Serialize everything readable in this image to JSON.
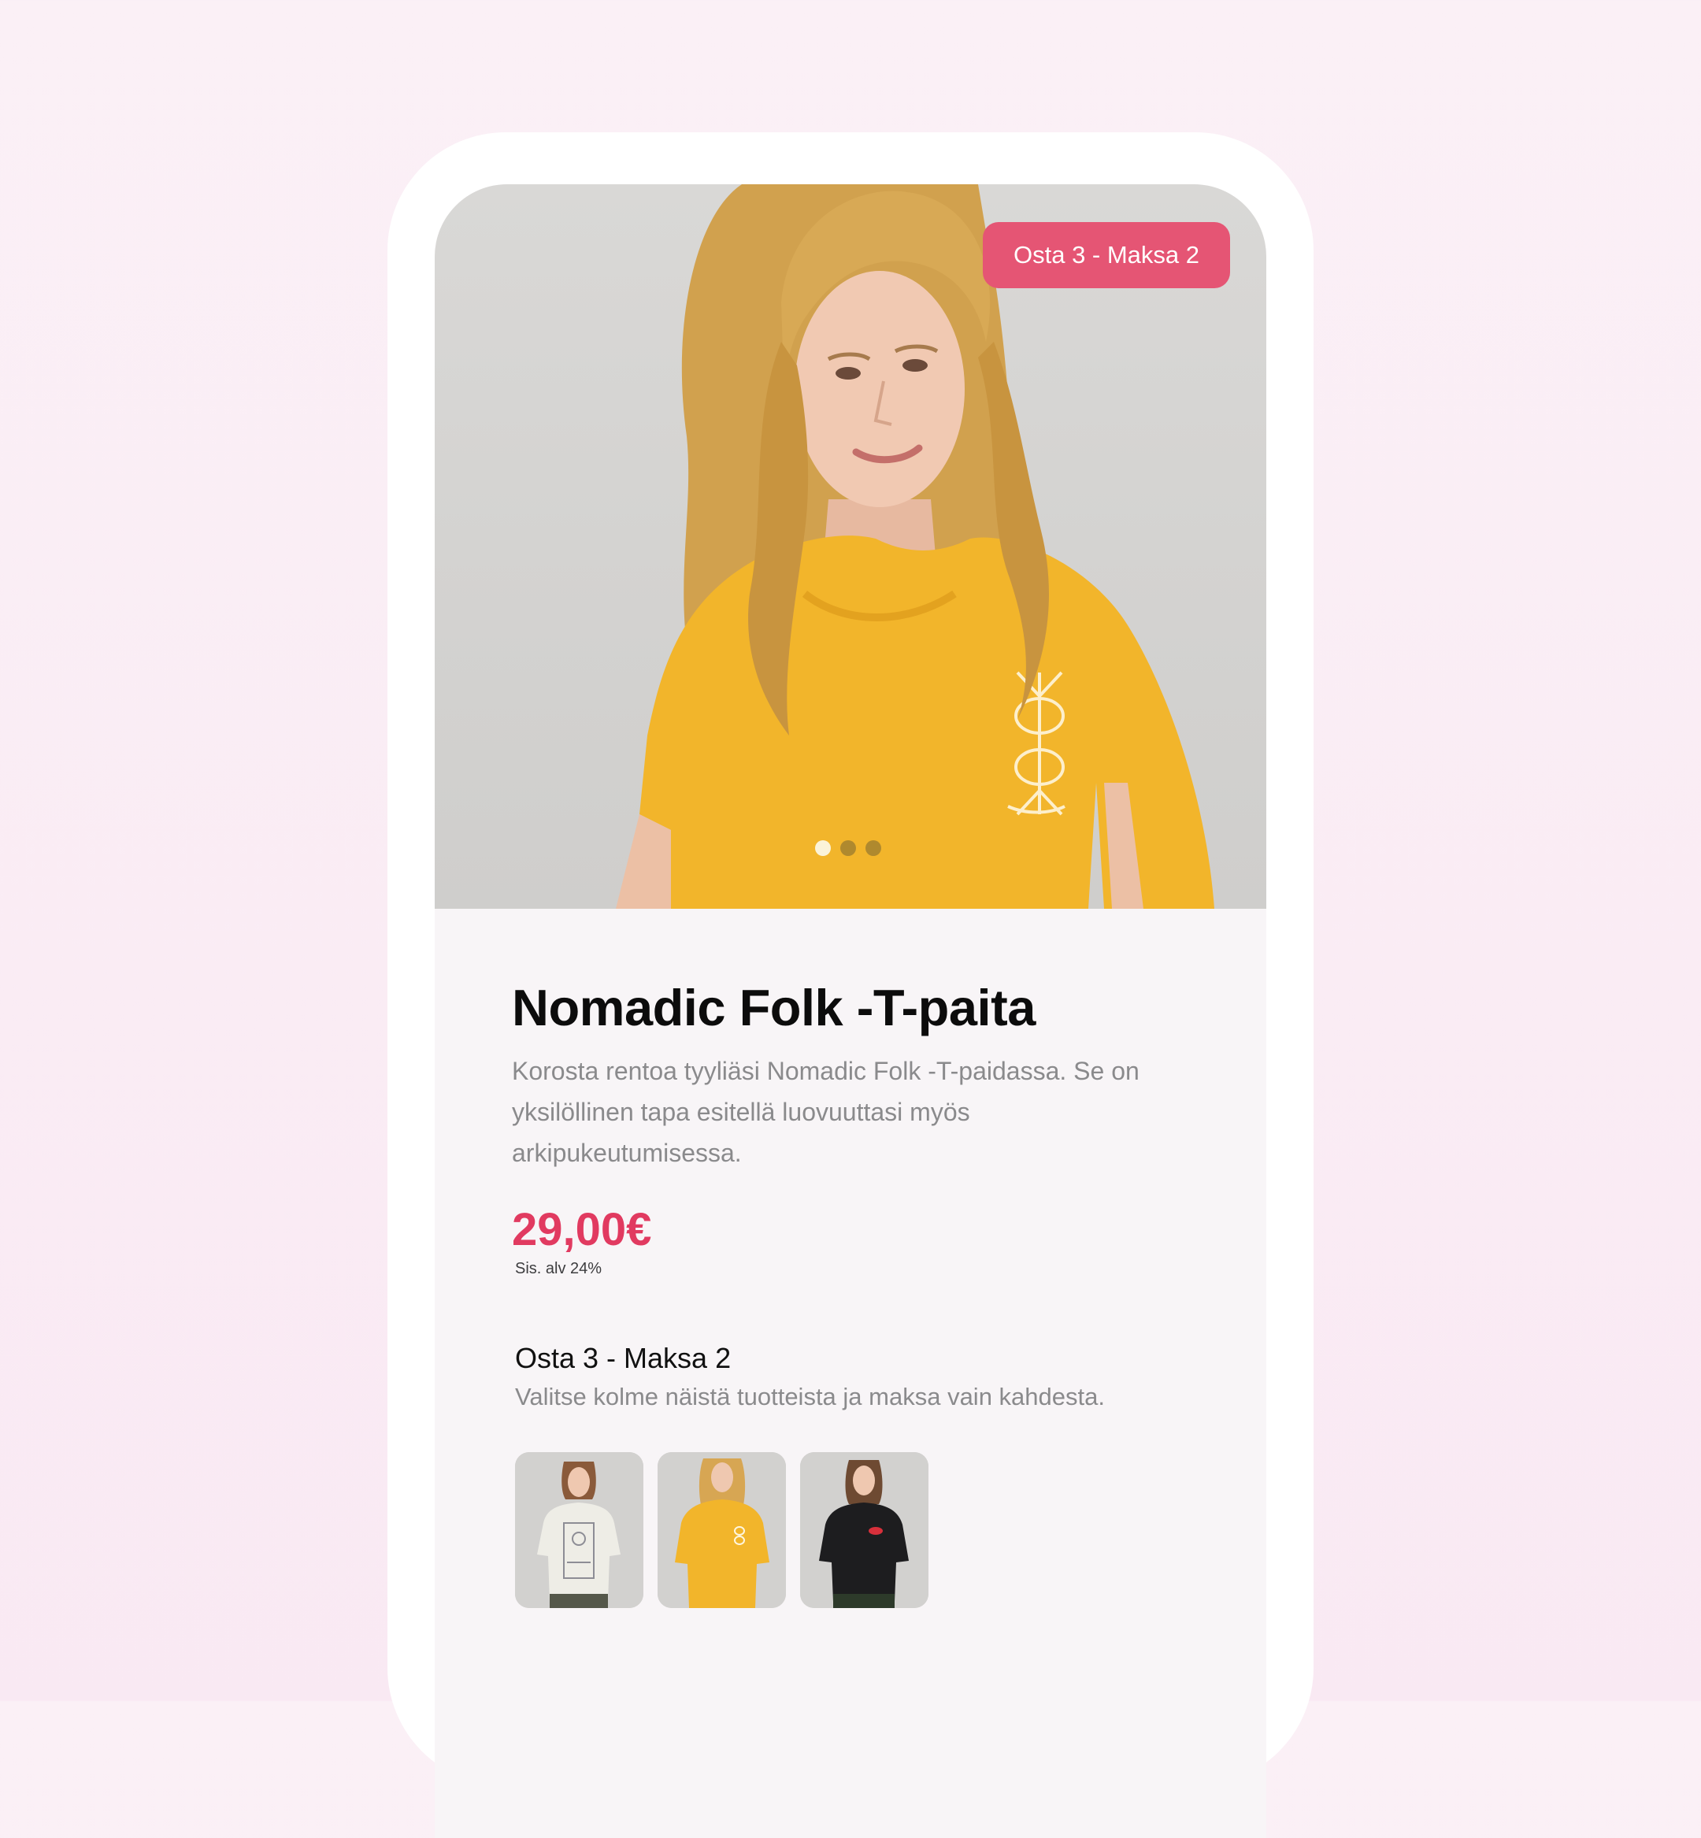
{
  "hero": {
    "promo_badge": "Osta 3 - Maksa 2",
    "carousel_total": 3,
    "carousel_active": 1
  },
  "product": {
    "title": "Nomadic Folk -T-paita",
    "description": "Korosta rentoa tyyliäsi Nomadic Folk -T-paidassa. Se on yksilöllinen tapa esitellä luovuuttasi myös arkipukeutumisessa.",
    "price": "29,00€",
    "vat_note": "Sis. alv 24%"
  },
  "offer": {
    "title": "Osta 3 - Maksa 2",
    "description": "Valitse kolme näistä tuotteista ja maksa vain kahdesta.",
    "thumbnails": [
      {
        "name": "white-tshirt",
        "color": "#eeede6"
      },
      {
        "name": "yellow-tshirt",
        "color": "#f4b72a"
      },
      {
        "name": "black-tshirt",
        "color": "#1d1d1f"
      }
    ]
  },
  "colors": {
    "accent": "#e13a60",
    "badge": "#e55574",
    "background": "#fbf0f6"
  }
}
